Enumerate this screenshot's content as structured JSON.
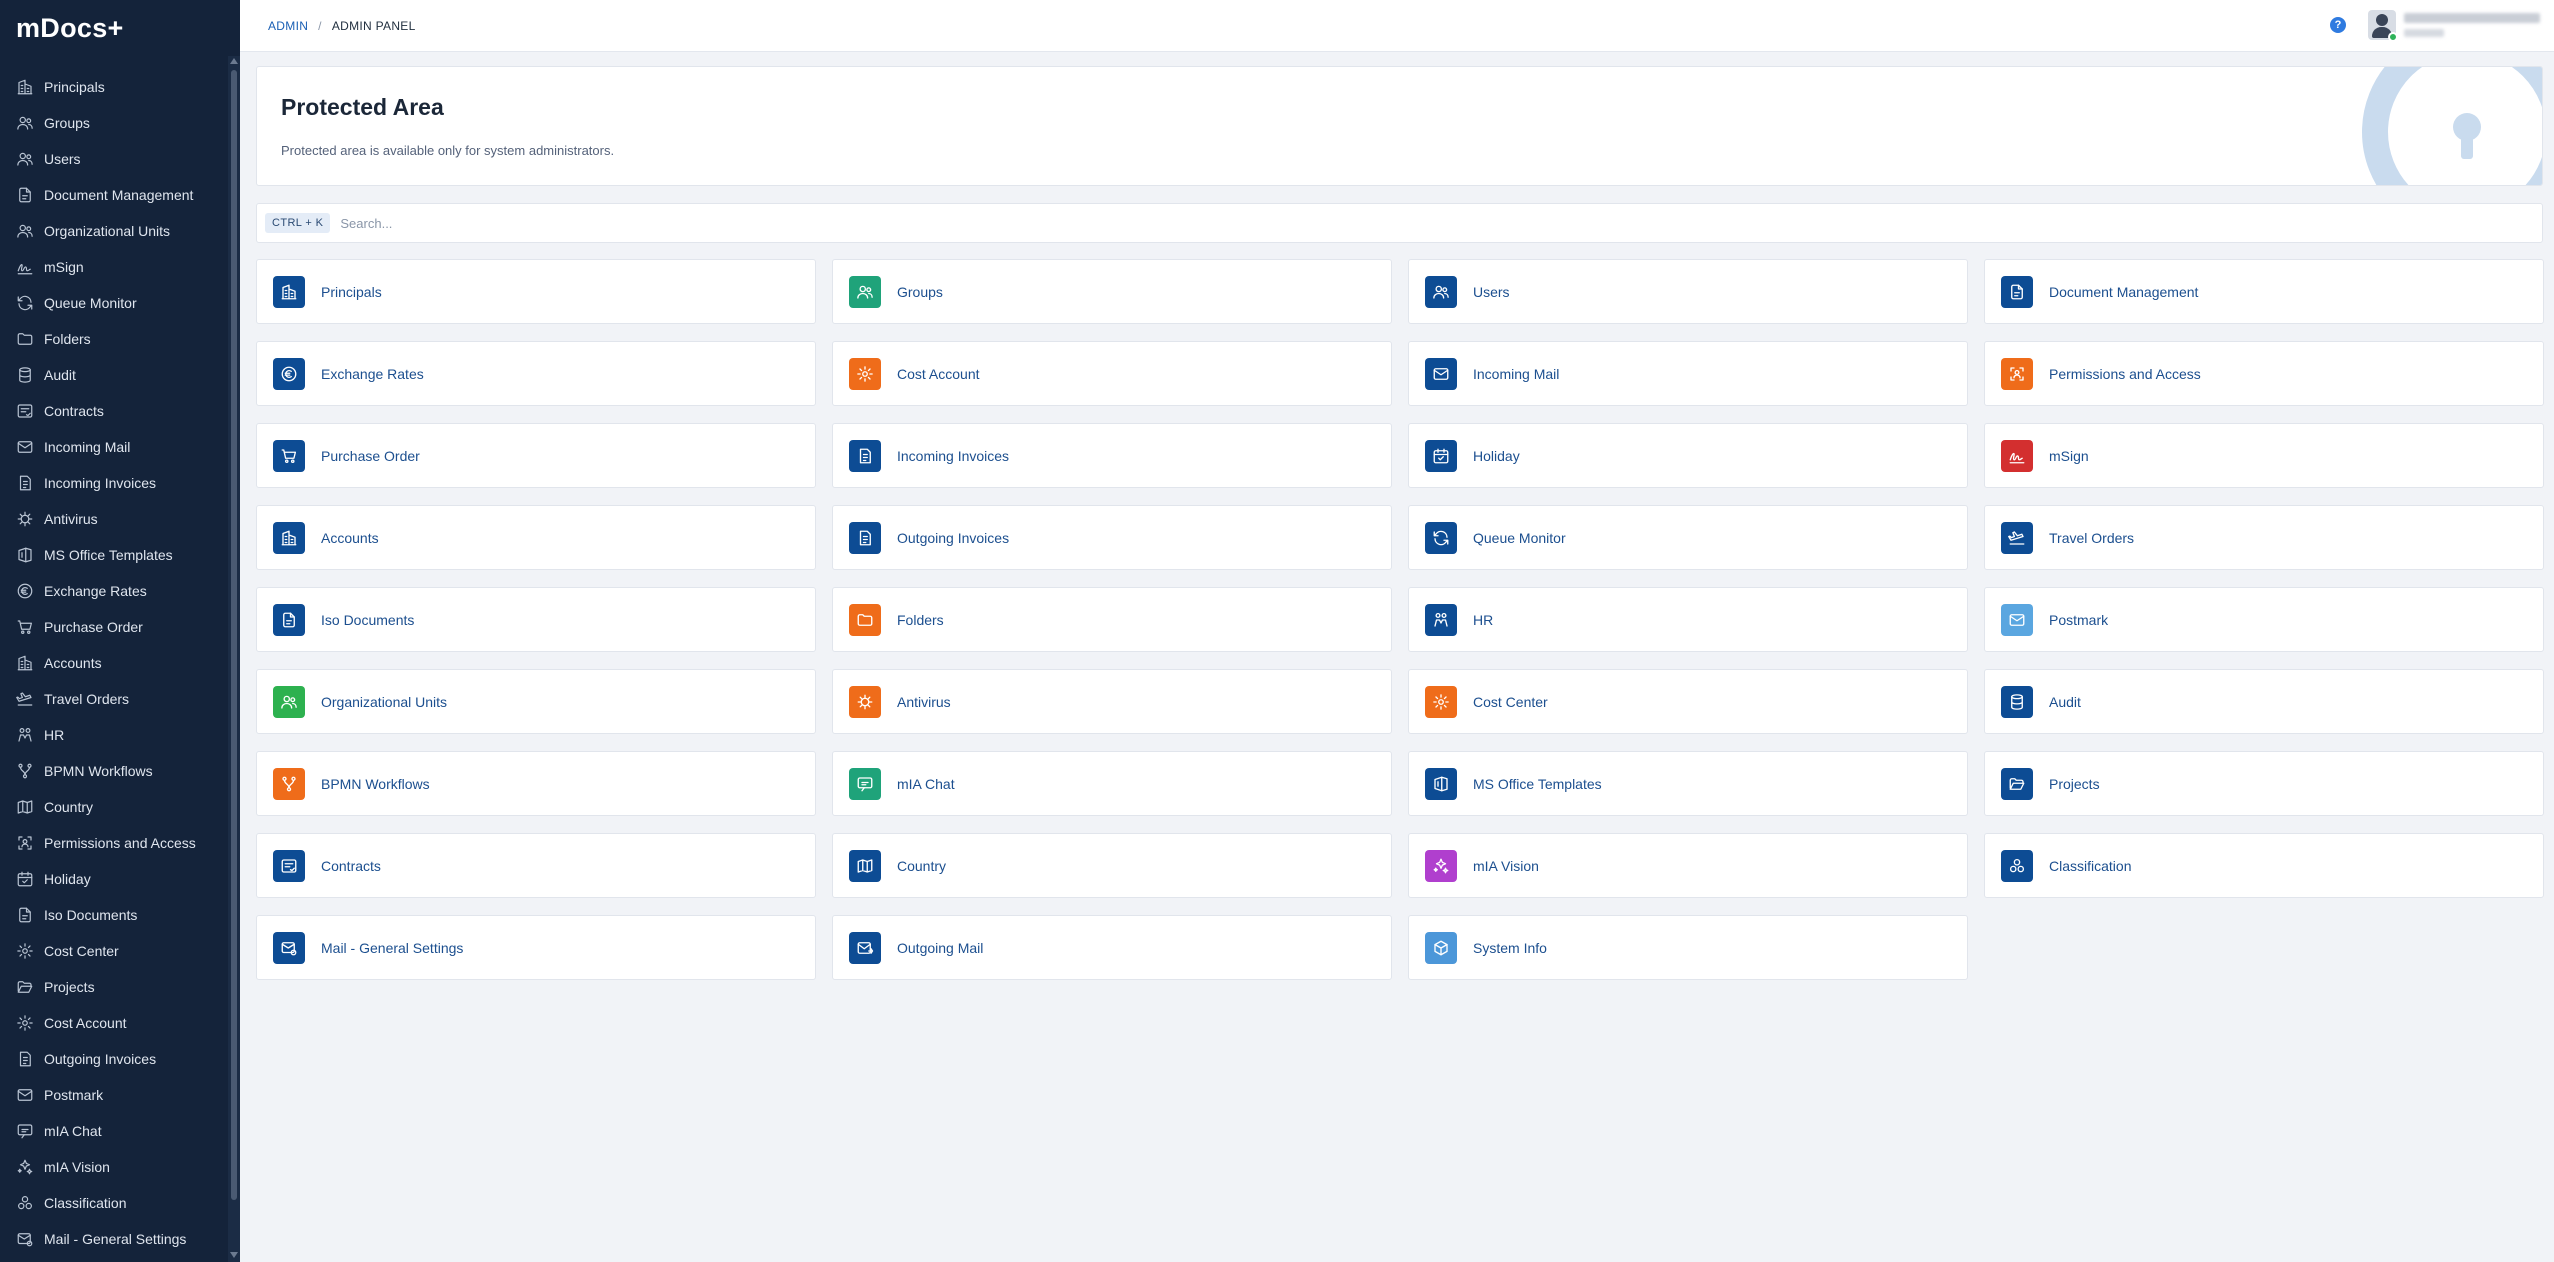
{
  "app": {
    "brand": "mDocs+"
  },
  "sidebar": {
    "items": [
      {
        "label": "Principals",
        "icon": "building-icon"
      },
      {
        "label": "Groups",
        "icon": "users-icon"
      },
      {
        "label": "Users",
        "icon": "users-icon"
      },
      {
        "label": "Document Management",
        "icon": "document-icon"
      },
      {
        "label": "Organizational Units",
        "icon": "users-icon"
      },
      {
        "label": "mSign",
        "icon": "signature-icon"
      },
      {
        "label": "Queue Monitor",
        "icon": "refresh-icon"
      },
      {
        "label": "Folders",
        "icon": "folder-icon"
      },
      {
        "label": "Audit",
        "icon": "database-icon"
      },
      {
        "label": "Contracts",
        "icon": "contract-icon"
      },
      {
        "label": "Incoming Mail",
        "icon": "mail-icon"
      },
      {
        "label": "Incoming Invoices",
        "icon": "invoice-icon"
      },
      {
        "label": "Antivirus",
        "icon": "virus-icon"
      },
      {
        "label": "MS Office Templates",
        "icon": "office-icon"
      },
      {
        "label": "Exchange Rates",
        "icon": "currency-icon"
      },
      {
        "label": "Purchase Order",
        "icon": "cart-icon"
      },
      {
        "label": "Accounts",
        "icon": "building-icon"
      },
      {
        "label": "Travel Orders",
        "icon": "plane-icon"
      },
      {
        "label": "HR",
        "icon": "hr-icon"
      },
      {
        "label": "BPMN Workflows",
        "icon": "workflow-icon"
      },
      {
        "label": "Country",
        "icon": "map-icon"
      },
      {
        "label": "Permissions and Access",
        "icon": "shield-user-icon"
      },
      {
        "label": "Holiday",
        "icon": "calendar-icon"
      },
      {
        "label": "Iso Documents",
        "icon": "document-icon"
      },
      {
        "label": "Cost Center",
        "icon": "gear-icon"
      },
      {
        "label": "Projects",
        "icon": "folder-open-icon"
      },
      {
        "label": "Cost Account",
        "icon": "gear-icon"
      },
      {
        "label": "Outgoing Invoices",
        "icon": "invoice-icon"
      },
      {
        "label": "Postmark",
        "icon": "mail-icon"
      },
      {
        "label": "mIA Chat",
        "icon": "chat-icon"
      },
      {
        "label": "mIA Vision",
        "icon": "sparkle-icon"
      },
      {
        "label": "Classification",
        "icon": "cluster-icon"
      },
      {
        "label": "Mail - General Settings",
        "icon": "mail-gear-icon"
      }
    ]
  },
  "topbar": {
    "breadcrumb": {
      "root": "ADMIN",
      "separator": "/",
      "current": "ADMIN PANEL"
    },
    "help_symbol": "?"
  },
  "hero": {
    "title": "Protected Area",
    "subtitle": "Protected area is available only for system administrators."
  },
  "search": {
    "shortcut": "CTRL + K",
    "placeholder": "Search...",
    "value": ""
  },
  "colors": {
    "blue": "#0d4c94",
    "green": "#1fa37a",
    "orange": "#ef6c1a",
    "red": "#d32f2f",
    "light_blue": "#5aa6e0",
    "bright_green": "#2db14f",
    "purple": "#b03fce",
    "sky": "#4c97d9"
  },
  "tiles": [
    {
      "label": "Principals",
      "icon": "building-icon",
      "color": "#0d4c94"
    },
    {
      "label": "Groups",
      "icon": "users-icon",
      "color": "#1fa37a"
    },
    {
      "label": "Users",
      "icon": "users-icon",
      "color": "#0d4c94"
    },
    {
      "label": "Document Management",
      "icon": "document-icon",
      "color": "#0d4c94"
    },
    {
      "label": "Exchange Rates",
      "icon": "currency-icon",
      "color": "#0d4c94"
    },
    {
      "label": "Cost Account",
      "icon": "gear-icon",
      "color": "#ef6c1a"
    },
    {
      "label": "Incoming Mail",
      "icon": "mail-icon",
      "color": "#0d4c94"
    },
    {
      "label": "Permissions and Access",
      "icon": "shield-user-icon",
      "color": "#ef6c1a"
    },
    {
      "label": "Purchase Order",
      "icon": "cart-icon",
      "color": "#0d4c94"
    },
    {
      "label": "Incoming Invoices",
      "icon": "invoice-icon",
      "color": "#0d4c94"
    },
    {
      "label": "Holiday",
      "icon": "calendar-icon",
      "color": "#0d4c94"
    },
    {
      "label": "mSign",
      "icon": "signature-icon",
      "color": "#d32f2f"
    },
    {
      "label": "Accounts",
      "icon": "building-icon",
      "color": "#0d4c94"
    },
    {
      "label": "Outgoing Invoices",
      "icon": "invoice-icon",
      "color": "#0d4c94"
    },
    {
      "label": "Queue Monitor",
      "icon": "refresh-icon",
      "color": "#0d4c94"
    },
    {
      "label": "Travel Orders",
      "icon": "plane-icon",
      "color": "#0d4c94"
    },
    {
      "label": "Iso Documents",
      "icon": "document-icon",
      "color": "#0d4c94"
    },
    {
      "label": "Folders",
      "icon": "folder-icon",
      "color": "#ef6c1a"
    },
    {
      "label": "HR",
      "icon": "hr-icon",
      "color": "#0d4c94"
    },
    {
      "label": "Postmark",
      "icon": "mail-icon",
      "color": "#5aa6e0"
    },
    {
      "label": "Organizational Units",
      "icon": "users-icon",
      "color": "#2db14f"
    },
    {
      "label": "Antivirus",
      "icon": "virus-icon",
      "color": "#ef6c1a"
    },
    {
      "label": "Cost Center",
      "icon": "gear-icon",
      "color": "#ef6c1a"
    },
    {
      "label": "Audit",
      "icon": "database-icon",
      "color": "#0d4c94"
    },
    {
      "label": "BPMN Workflows",
      "icon": "workflow-icon",
      "color": "#ef6c1a"
    },
    {
      "label": "mIA Chat",
      "icon": "chat-icon",
      "color": "#1fa37a"
    },
    {
      "label": "MS Office Templates",
      "icon": "office-icon",
      "color": "#0d4c94"
    },
    {
      "label": "Projects",
      "icon": "folder-open-icon",
      "color": "#0d4c94"
    },
    {
      "label": "Contracts",
      "icon": "contract-icon",
      "color": "#0d4c94"
    },
    {
      "label": "Country",
      "icon": "map-icon",
      "color": "#0d4c94"
    },
    {
      "label": "mIA Vision",
      "icon": "sparkle-icon",
      "color": "#b03fce"
    },
    {
      "label": "Classification",
      "icon": "cluster-icon",
      "color": "#0d4c94"
    },
    {
      "label": "Mail - General Settings",
      "icon": "mail-gear-icon",
      "color": "#0d4c94"
    },
    {
      "label": "Outgoing Mail",
      "icon": "mail-out-icon",
      "color": "#0d4c94"
    },
    {
      "label": "System Info",
      "icon": "cube-icon",
      "color": "#4c97d9"
    }
  ]
}
